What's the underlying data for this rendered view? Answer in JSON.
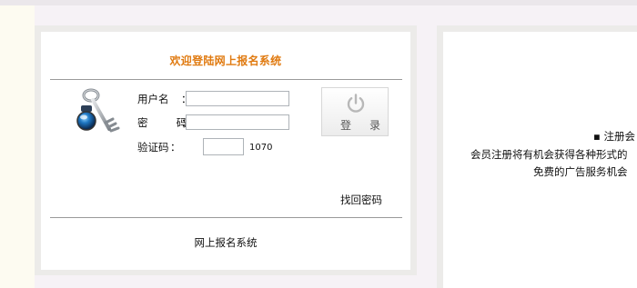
{
  "login_panel": {
    "title": "欢迎登陆网上报名系统",
    "title_color": "#e07a10",
    "username_label": "用户名",
    "password_label": "密  码",
    "captcha_label": "验证码",
    "colon": "：",
    "username_value": "",
    "password_value": "",
    "captcha_value": "",
    "captcha_code": "1070",
    "login_button": "登录",
    "login_button_icon": "power-icon",
    "recover_password": "找回密码",
    "footer": "网上报名系统",
    "side_icon": "key-icon"
  },
  "right_panel": {
    "line1": "▪ 注册会",
    "line2": "会员注册将有机会获得各种形式的",
    "line3": "免费的广告服务机会"
  }
}
